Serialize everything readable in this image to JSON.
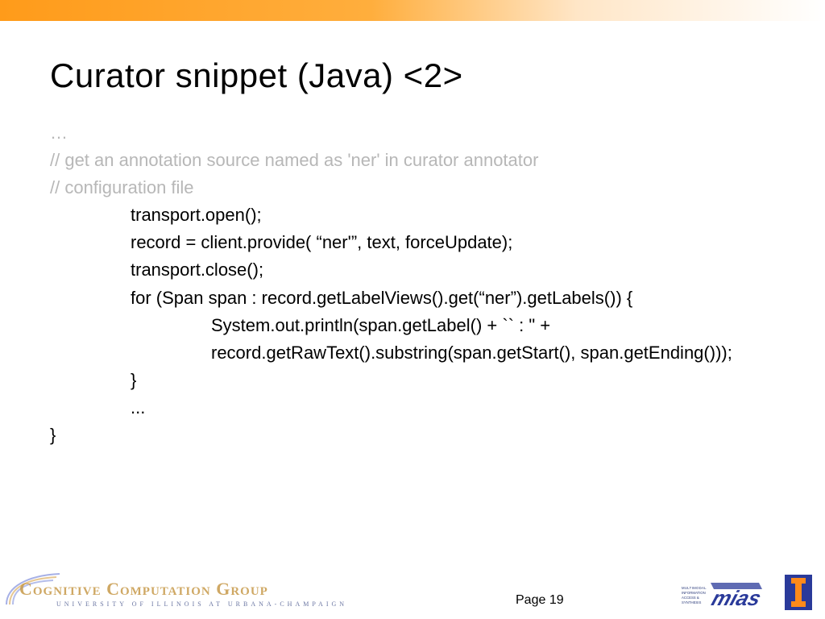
{
  "title": "Curator snippet (Java) <2>",
  "code": {
    "l1": "…",
    "l2": "// get an annotation source named as 'ner' in curator annotator",
    "l3": "// configuration file",
    "l4": "transport.open();",
    "l5": "record = client.provide( “ner'”, text, forceUpdate);",
    "l6": "transport.close();",
    "l7": "for (Span span : record.getLabelViews().get(“ner”).getLabels()) {",
    "l8": "System.out.println(span.getLabel() + `` : \" + record.getRawText().substring(span.getStart(), span.getEnding()));",
    "l9": "}",
    "l10": "...",
    "l11": "}"
  },
  "footer": {
    "ccg_name": "Cognitive Computation Group",
    "ccg_sub": "UNIVERSITY OF ILLINOIS AT URBANA-CHAMPAIGN",
    "page": "Page 19",
    "mias": "MIAS",
    "mias_sub": "MULTIMODAL INFORMATION ACCESS & SYNTHESIS"
  }
}
